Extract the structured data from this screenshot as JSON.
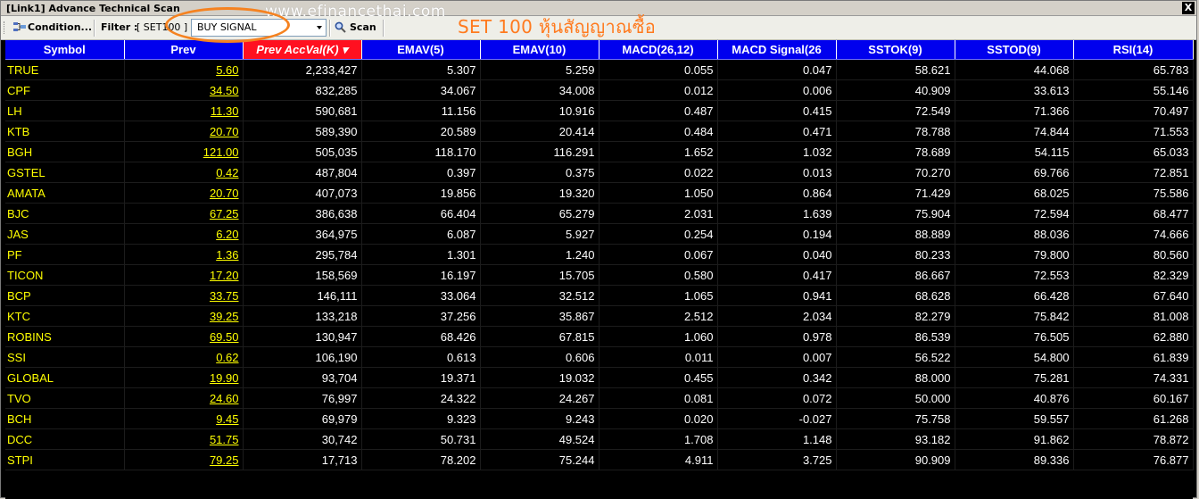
{
  "window": {
    "title": "[Link1] Advance Technical Scan",
    "watermark": "www.efinancethai.com",
    "close_label": "X"
  },
  "toolbar": {
    "condition_label": "Condition...",
    "filter_label": "Filter :",
    "filter_value": "[ SET100 ]",
    "signal_select": "BUY SIGNAL",
    "scan_label": "Scan"
  },
  "annotation": {
    "title": "SET 100 หุ้นสัญญาณซื้อ"
  },
  "colors": {
    "header_bg": "#0000ee",
    "sorted_header_bg": "#ff1020",
    "symbol_text": "#ffff00",
    "value_text": "#ffffff",
    "grid_bg": "#000000",
    "annotation_orange": "#f58220"
  },
  "table": {
    "columns": [
      "Symbol",
      "Prev",
      "Prev AccVal(K)",
      "EMAV(5)",
      "EMAV(10)",
      "MACD(26,12)",
      "MACD Signal(26",
      "SSTOK(9)",
      "SSTOD(9)",
      "RSI(14)"
    ],
    "sorted_column": "Prev AccVal(K)",
    "sort_direction": "descending",
    "rows": [
      [
        "TRUE",
        "5.60",
        "2,233,427",
        "5.307",
        "5.259",
        "0.055",
        "0.047",
        "58.621",
        "44.068",
        "65.783"
      ],
      [
        "CPF",
        "34.50",
        "832,285",
        "34.067",
        "34.008",
        "0.012",
        "0.006",
        "40.909",
        "33.613",
        "55.146"
      ],
      [
        "LH",
        "11.30",
        "590,681",
        "11.156",
        "10.916",
        "0.487",
        "0.415",
        "72.549",
        "71.366",
        "70.497"
      ],
      [
        "KTB",
        "20.70",
        "589,390",
        "20.589",
        "20.414",
        "0.484",
        "0.471",
        "78.788",
        "74.844",
        "71.553"
      ],
      [
        "BGH",
        "121.00",
        "505,035",
        "118.170",
        "116.291",
        "1.652",
        "1.032",
        "78.689",
        "54.115",
        "65.033"
      ],
      [
        "GSTEL",
        "0.42",
        "487,804",
        "0.397",
        "0.375",
        "0.022",
        "0.013",
        "70.270",
        "69.766",
        "72.851"
      ],
      [
        "AMATA",
        "20.70",
        "407,073",
        "19.856",
        "19.320",
        "1.050",
        "0.864",
        "71.429",
        "68.025",
        "75.586"
      ],
      [
        "BJC",
        "67.25",
        "386,638",
        "66.404",
        "65.279",
        "2.031",
        "1.639",
        "75.904",
        "72.594",
        "68.477"
      ],
      [
        "JAS",
        "6.20",
        "364,975",
        "6.087",
        "5.927",
        "0.254",
        "0.194",
        "88.889",
        "88.036",
        "74.666"
      ],
      [
        "PF",
        "1.36",
        "295,784",
        "1.301",
        "1.240",
        "0.067",
        "0.040",
        "80.233",
        "79.800",
        "80.560"
      ],
      [
        "TICON",
        "17.20",
        "158,569",
        "16.197",
        "15.705",
        "0.580",
        "0.417",
        "86.667",
        "72.553",
        "82.329"
      ],
      [
        "BCP",
        "33.75",
        "146,111",
        "33.064",
        "32.512",
        "1.065",
        "0.941",
        "68.628",
        "66.428",
        "67.640"
      ],
      [
        "KTC",
        "39.25",
        "133,218",
        "37.256",
        "35.867",
        "2.512",
        "2.034",
        "82.279",
        "75.842",
        "81.008"
      ],
      [
        "ROBINS",
        "69.50",
        "130,947",
        "68.426",
        "67.815",
        "1.060",
        "0.978",
        "86.539",
        "76.505",
        "62.880"
      ],
      [
        "SSI",
        "0.62",
        "106,190",
        "0.613",
        "0.606",
        "0.011",
        "0.007",
        "56.522",
        "54.800",
        "61.839"
      ],
      [
        "GLOBAL",
        "19.90",
        "93,704",
        "19.371",
        "19.032",
        "0.455",
        "0.342",
        "88.000",
        "75.281",
        "74.331"
      ],
      [
        "TVO",
        "24.60",
        "76,997",
        "24.322",
        "24.267",
        "0.081",
        "0.072",
        "50.000",
        "40.876",
        "60.167"
      ],
      [
        "BCH",
        "9.45",
        "69,979",
        "9.323",
        "9.243",
        "0.020",
        "-0.027",
        "75.758",
        "59.557",
        "61.268"
      ],
      [
        "DCC",
        "51.75",
        "30,742",
        "50.731",
        "49.524",
        "1.708",
        "1.148",
        "93.182",
        "91.862",
        "78.872"
      ],
      [
        "STPI",
        "79.25",
        "17,713",
        "78.202",
        "75.244",
        "4.911",
        "3.725",
        "90.909",
        "89.336",
        "76.877"
      ]
    ]
  }
}
